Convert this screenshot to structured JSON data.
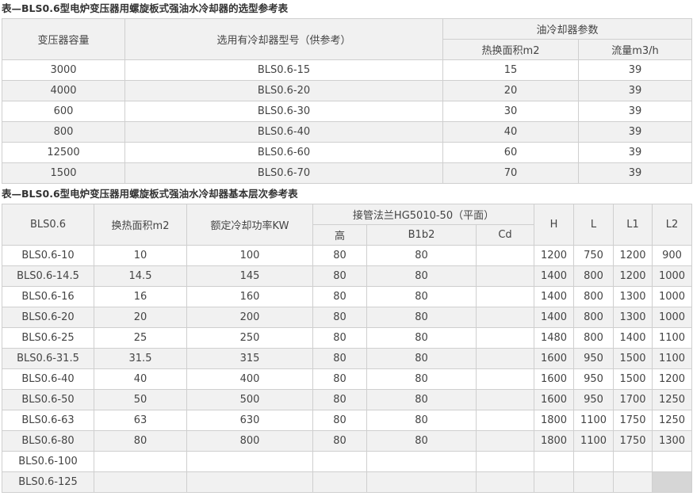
{
  "table1": {
    "caption": "表—BLS0.6型电炉变压器用螺旋板式强油水冷却器的选型参考表",
    "header": {
      "capacity": "变压器容量",
      "model": "选用有冷却器型号（供参考）",
      "params_group": "油冷却器参数",
      "area": "热换面积m2",
      "flow": "流量m3/h"
    },
    "rows": [
      [
        "3000",
        "BLS0.6-15",
        "15",
        "39"
      ],
      [
        "4000",
        "BLS0.6-20",
        "20",
        "39"
      ],
      [
        "600",
        "BLS0.6-30",
        "30",
        "39"
      ],
      [
        "800",
        "BLS0.6-40",
        "40",
        "39"
      ],
      [
        "12500",
        "BLS0.6-60",
        "60",
        "39"
      ],
      [
        "1500",
        "BLS0.6-70",
        "70",
        "39"
      ]
    ]
  },
  "table2": {
    "caption": "表—BLS0.6型电炉变压器用螺旋板式强油水冷却器基本层次参考表",
    "header": {
      "model": "BLS0.6",
      "area": "换热面积m2",
      "power": "额定冷却功率KW",
      "flange_group": "接管法兰HG5010-50（平面）",
      "gao": "高",
      "b1b2": "B1b2",
      "cd": "Cd",
      "h": "H",
      "l": "L",
      "l1": "L1",
      "l2": "L2"
    },
    "rows": [
      [
        "BLS0.6-10",
        "10",
        "100",
        "80",
        "80",
        "",
        "1200",
        "750",
        "1200",
        "900"
      ],
      [
        "BLS0.6-14.5",
        "14.5",
        "145",
        "80",
        "80",
        "",
        "1400",
        "800",
        "1200",
        "1000"
      ],
      [
        "BLS0.6-16",
        "16",
        "160",
        "80",
        "80",
        "",
        "1400",
        "800",
        "1300",
        "1000"
      ],
      [
        "BLS0.6-20",
        "20",
        "200",
        "80",
        "80",
        "",
        "1400",
        "800",
        "1300",
        "1000"
      ],
      [
        "BLS0.6-25",
        "25",
        "250",
        "80",
        "80",
        "",
        "1480",
        "800",
        "1400",
        "1100"
      ],
      [
        "BLS0.6-31.5",
        "31.5",
        "315",
        "80",
        "80",
        "",
        "1600",
        "950",
        "1500",
        "1100"
      ],
      [
        "BLS0.6-40",
        "40",
        "400",
        "80",
        "80",
        "",
        "1600",
        "950",
        "1500",
        "1200"
      ],
      [
        "BLS0.6-50",
        "50",
        "500",
        "80",
        "80",
        "",
        "1600",
        "950",
        "1700",
        "1250"
      ],
      [
        "BLS0.6-63",
        "63",
        "630",
        "80",
        "80",
        "",
        "1800",
        "1100",
        "1750",
        "1250"
      ],
      [
        "BLS0.6-80",
        "80",
        "800",
        "80",
        "80",
        "",
        "1800",
        "1100",
        "1750",
        "1300"
      ],
      [
        "BLS0.6-100",
        "",
        "",
        "",
        "",
        "",
        "",
        "",
        "",
        ""
      ],
      [
        "BLS0.6-125",
        "",
        "",
        "",
        "",
        "",
        "",
        "",
        "",
        ""
      ]
    ]
  },
  "colors": {
    "border": "#cfcfcf",
    "header_bg": "#f1f1f1",
    "stripe_bg": "#f1f1f1",
    "text": "#444444"
  }
}
